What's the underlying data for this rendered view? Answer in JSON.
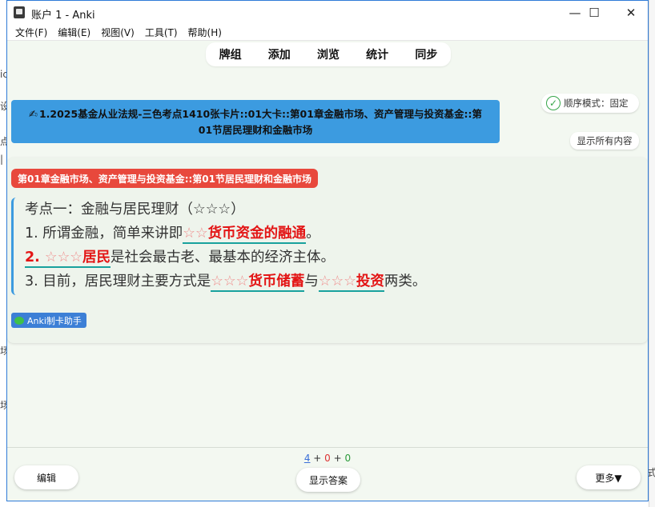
{
  "window": {
    "title": "账户 1 - Anki",
    "minimize": "—",
    "maximize": "☐",
    "close": "✕"
  },
  "menu": [
    "文件(F)",
    "编辑(E)",
    "视图(V)",
    "工具(T)",
    "帮助(H)"
  ],
  "toolbar": [
    "牌组",
    "添加",
    "浏览",
    "统计",
    "同步"
  ],
  "deck_path": "1.2025基金从业法规-三色考点1410张卡片::01大卡::第01章金融市场、资产管理与投资基金::第01节居民理财和金融市场",
  "order_mode": {
    "check": "✓",
    "label": "顺序模式：固定"
  },
  "show_all_label": "显示所有内容",
  "chapter_tag": "第01章金融市场、资产管理与投资基金::第01节居民理财和金融市场",
  "card": {
    "heading": "考点一：金融与居民理财（☆☆☆）",
    "line1": {
      "prefix": "1. 所谓金融，简单来讲即",
      "stars": "☆☆",
      "key": "货币资金的融通",
      "suffix": "。"
    },
    "line2": {
      "num": "2. ",
      "stars": "☆☆☆",
      "key": "居民",
      "suffix": "是社会最古老、最基本的经济主体。"
    },
    "line3": {
      "prefix": "3. 目前，居民理财主要方式是",
      "stars1": "☆☆☆",
      "key1": "货币储蓄",
      "mid": "与",
      "stars2": "☆☆☆",
      "key2": "投资",
      "suffix": "两类。"
    }
  },
  "helper_badge": "Anki制卡助手",
  "counts": {
    "new": "4",
    "plus1": " + ",
    "learn": "0",
    "plus2": " + ",
    "review": "0"
  },
  "buttons": {
    "edit": "编辑",
    "show_answer": "显示答案",
    "more": "更多▼"
  },
  "background_glyphs": [
    "ic",
    "设",
    "点",
    "|",
    "场",
    "场"
  ],
  "background_right_text": "式"
}
